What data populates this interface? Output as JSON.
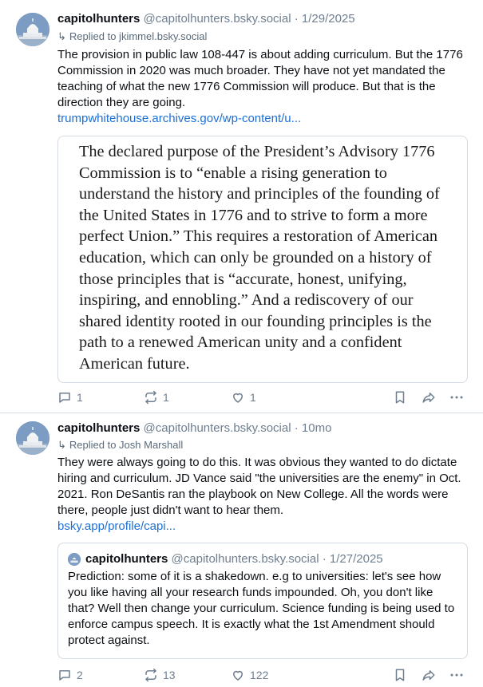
{
  "post1": {
    "display_name": "capitolhunters",
    "handle": "@capitolhunters.bsky.social",
    "separator": "·",
    "date": "1/29/2025",
    "replied_to": "Replied to jkimmel.bsky.social",
    "text": "The provision in public law 108-447  is about adding curriculum. But the 1776 Commission in 2020 was much broader. They have not yet mandated the teaching of what the new 1776 Commission will produce. But that is the direction they are going.",
    "link": "trumpwhitehouse.archives.gov/wp-content/u...",
    "image_text": "The declared purpose of the President’s Advisory 1776 Commission is to “enable a rising generation to understand the history and principles of the founding of the United States in 1776 and to strive to form a more perfect Union.” This requires a restoration of American education, which can only be grounded on a history of those principles that is “accurate, honest, unifying, inspiring, and ennobling.”  And a rediscovery of our shared identity rooted in our founding principles is the path to a renewed American unity and a confident American future.",
    "replies": "1",
    "reposts": "1",
    "likes": "1"
  },
  "post2": {
    "display_name": "capitolhunters",
    "handle": "@capitolhunters.bsky.social",
    "separator": "·",
    "date": "10mo",
    "replied_to": "Replied to Josh Marshall",
    "text": "They were always going to do this. It was obvious they wanted to do dictate hiring and curriculum. JD Vance said \"the universities are the enemy\" in Oct. 2021. Ron DeSantis ran the playbook on New College. All the words were there, people just didn't want to hear them.",
    "link": "bsky.app/profile/capi...",
    "quote": {
      "display_name": "capitolhunters",
      "handle": "@capitolhunters.bsky.social",
      "separator": "·",
      "date": "1/27/2025",
      "text": "Prediction: some of it is a shakedown. e.g to universities: let's see how you like having all your research funds impounded. Oh, you don't like that? Well then change your curriculum. Science funding is being used to enforce campus speech. It is exactly what the 1st Amendment should protect against."
    },
    "replies": "2",
    "reposts": "13",
    "likes": "122"
  },
  "icons": [
    "avatar-capitol-icon",
    "reply-arrow-icon",
    "comment-icon",
    "repost-icon",
    "heart-icon",
    "bookmark-icon",
    "share-icon",
    "more-icon"
  ],
  "colors": {
    "link": "#1d6fd8",
    "muted": "#6f7f8f",
    "border": "#d4dbe2"
  }
}
